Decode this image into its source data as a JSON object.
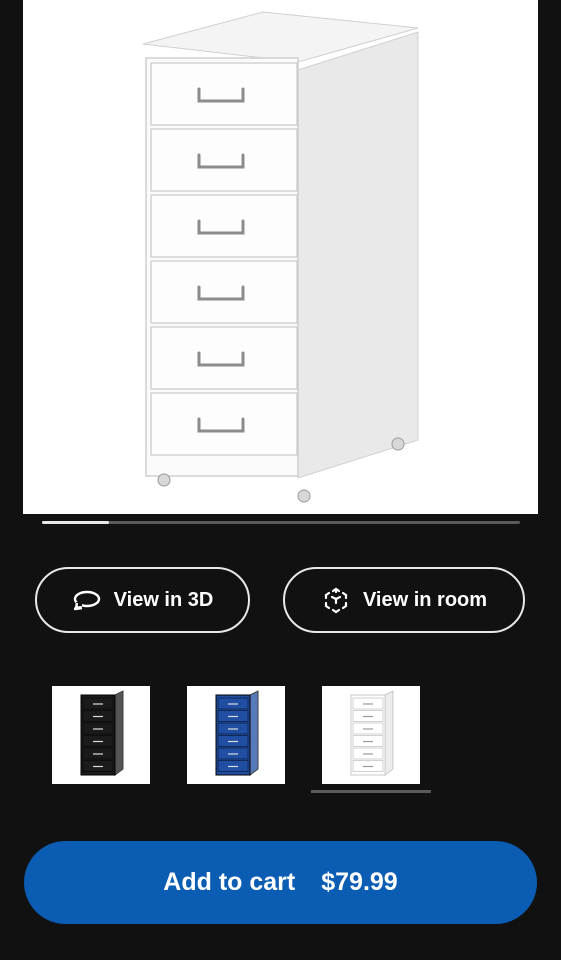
{
  "product": {
    "image_icon": "white-drawer-cabinet-image",
    "gallery_progress": 0.14
  },
  "actions": {
    "view_3d": {
      "label": "View in 3D",
      "icon": "rotate-3d-icon"
    },
    "view_room": {
      "label": "View in room",
      "icon": "ar-cube-icon"
    }
  },
  "colors": {
    "options": [
      {
        "name": "black",
        "color": "#1b1b1b",
        "selected": false
      },
      {
        "name": "blue",
        "color": "#1f4ea3",
        "selected": false
      },
      {
        "name": "white",
        "color": "#ffffff",
        "selected": true
      }
    ]
  },
  "cart": {
    "label": "Add to cart",
    "price": "$79.99",
    "accent": "#0b5cb3"
  }
}
